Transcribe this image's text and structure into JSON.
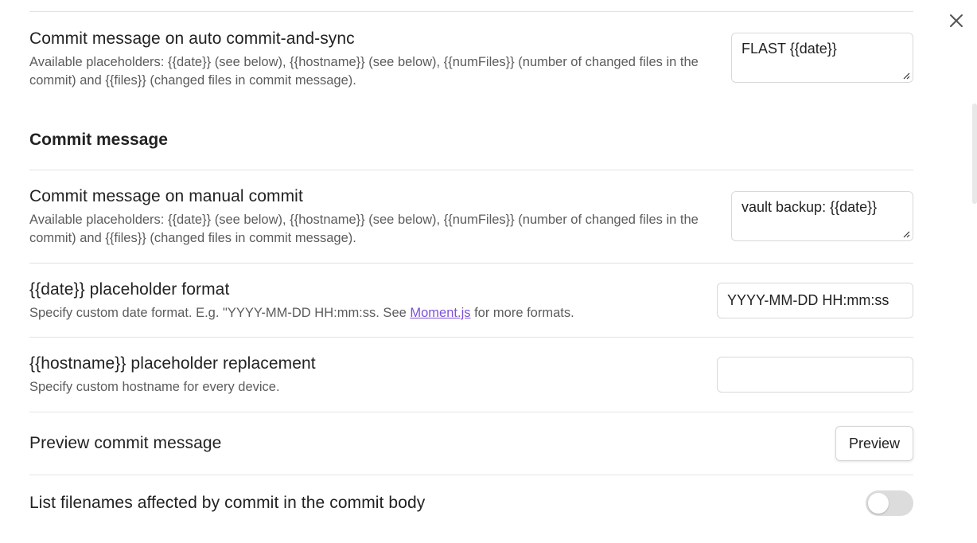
{
  "close_icon": "close-icon",
  "auto_commit": {
    "name": "Commit message on auto commit-and-sync",
    "desc": "Available placeholders: {{date}} (see below), {{hostname}} (see below), {{numFiles}} (number of changed files in the commit) and {{files}} (changed files in commit message).",
    "value": "FLAST {{date}}"
  },
  "section_heading": "Commit message",
  "manual_commit": {
    "name": "Commit message on manual commit",
    "desc": "Available placeholders: {{date}} (see below), {{hostname}} (see below), {{numFiles}} (number of changed files in the commit) and {{files}} (changed files in commit message).",
    "value": "vault backup: {{date}}"
  },
  "date_format": {
    "name": "{{date}} placeholder format",
    "desc_prefix": "Specify custom date format. E.g. \"YYYY-MM-DD HH:mm:ss. See ",
    "desc_link": "Moment.js",
    "desc_suffix": " for more formats.",
    "value": "YYYY-MM-DD HH:mm:ss"
  },
  "hostname": {
    "name": "{{hostname}} placeholder replacement",
    "desc": "Specify custom hostname for every device.",
    "value": ""
  },
  "preview": {
    "name": "Preview commit message",
    "button_label": "Preview"
  },
  "list_filenames": {
    "name": "List filenames affected by commit in the commit body",
    "enabled": false
  }
}
